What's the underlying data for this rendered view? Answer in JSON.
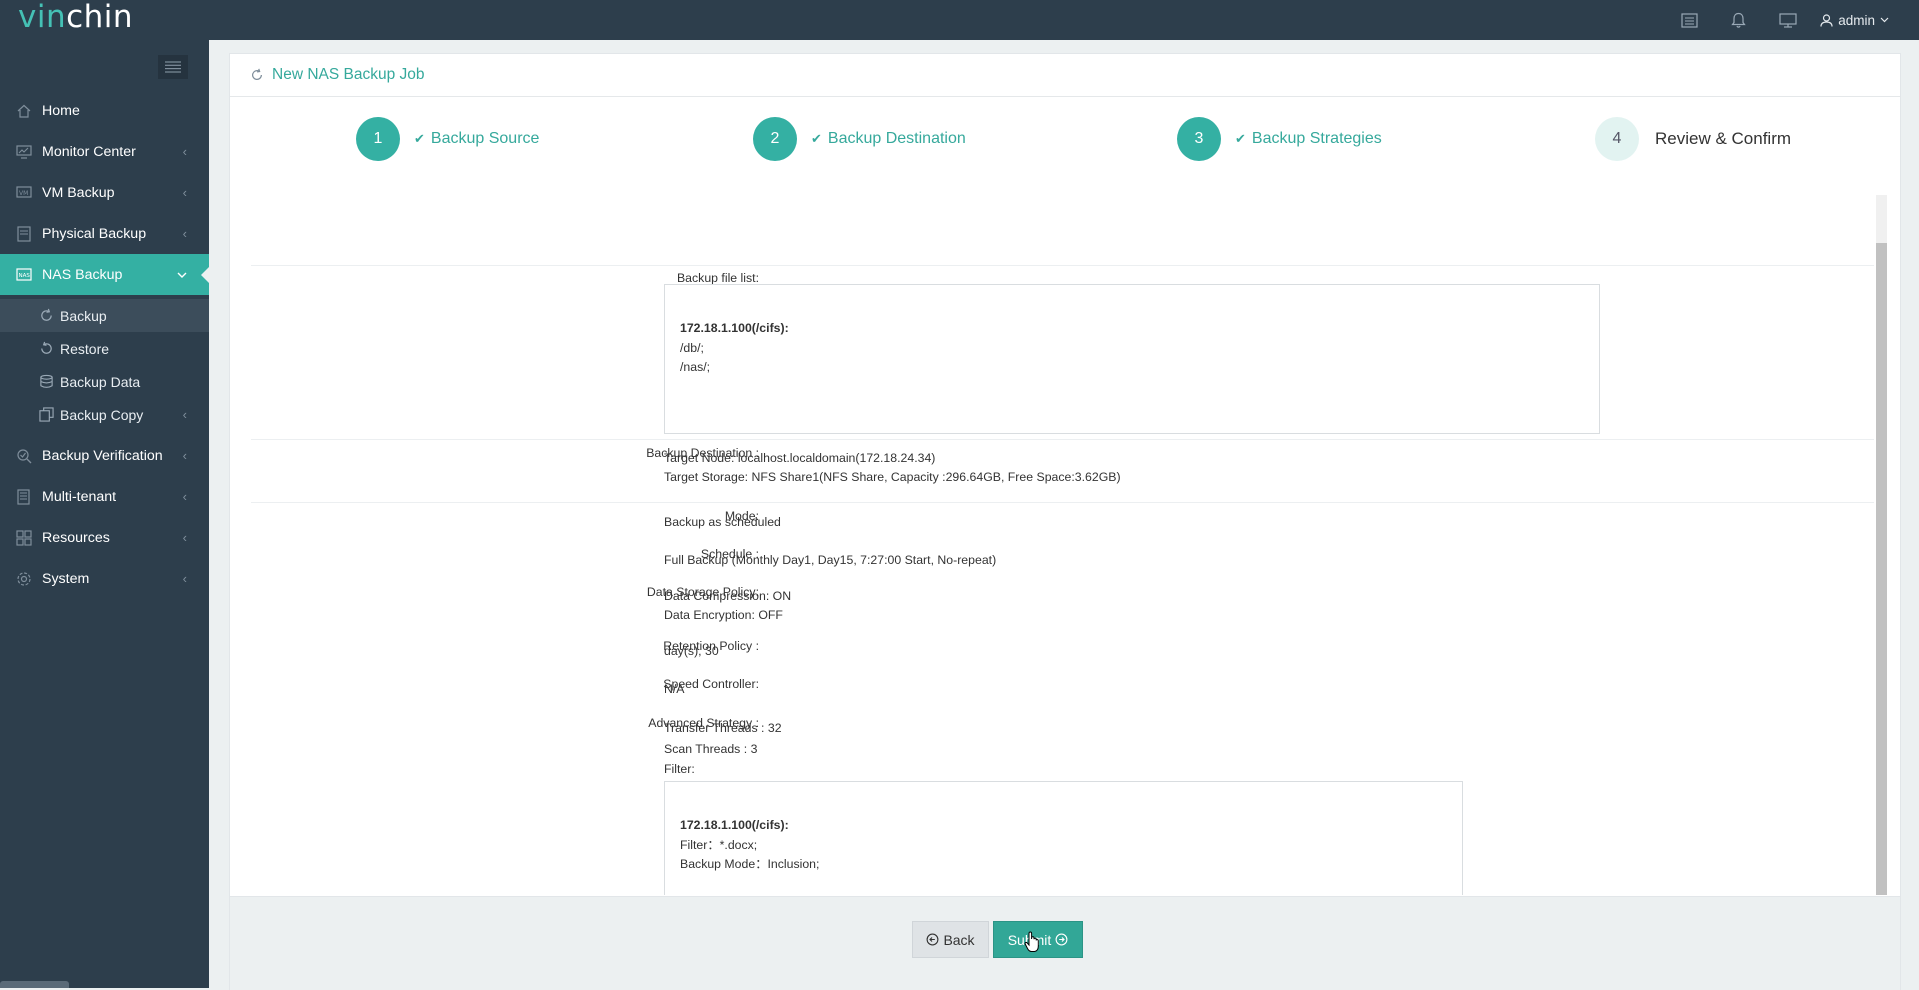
{
  "brand": {
    "part1": "vin",
    "part2": "chin"
  },
  "topbar": {
    "user": "admin",
    "icons": [
      "list-icon",
      "bell-icon",
      "monitor-icon",
      "user-icon"
    ]
  },
  "sidebar": {
    "items": [
      {
        "label": "Home",
        "icon": "home-icon"
      },
      {
        "label": "Monitor Center",
        "icon": "monitor-center-icon"
      },
      {
        "label": "VM Backup",
        "icon": "vm-backup-icon"
      },
      {
        "label": "Physical Backup",
        "icon": "physical-backup-icon"
      },
      {
        "label": "NAS Backup",
        "icon": "nas-icon"
      }
    ],
    "nas_sub": [
      {
        "label": "Backup",
        "icon": "refresh-icon"
      },
      {
        "label": "Restore",
        "icon": "restore-icon"
      },
      {
        "label": "Backup Data",
        "icon": "database-icon"
      },
      {
        "label": "Backup Copy",
        "icon": "copy-icon"
      }
    ],
    "items_after": [
      {
        "label": "Backup Verification",
        "icon": "verification-icon"
      },
      {
        "label": "Multi-tenant",
        "icon": "multi-tenant-icon"
      },
      {
        "label": "Resources",
        "icon": "resources-icon"
      },
      {
        "label": "System",
        "icon": "system-icon"
      }
    ]
  },
  "page": {
    "title": "New NAS Backup Job"
  },
  "steps": [
    {
      "num": "1",
      "label": "Backup Source"
    },
    {
      "num": "2",
      "label": "Backup Destination"
    },
    {
      "num": "3",
      "label": "Backup Strategies"
    },
    {
      "num": "4",
      "label": "Review & Confirm"
    }
  ],
  "review": {
    "backup_file_list": {
      "label": "Backup file list:",
      "host": "172.18.1.100(/cifs):",
      "paths": [
        "/db/;",
        "/nas/;"
      ]
    },
    "destination": {
      "label": "Backup Destination :",
      "node": "Target Node: localhost.localdomain(172.18.24.34)",
      "storage": "Target Storage: NFS Share1(NFS Share, Capacity :296.64GB, Free Space:3.62GB)"
    },
    "mode": {
      "label": "Mode:",
      "value": "Backup as scheduled"
    },
    "schedule": {
      "label": "Schedule :",
      "value": "Full Backup (Monthly Day1, Day15, 7:27:00 Start, No-repeat)"
    },
    "storage_policy": {
      "label": "Data Storage Policy:",
      "compression": "Data Compression: ON",
      "encryption": "Data Encryption: OFF"
    },
    "retention": {
      "label": "Retention Policy :",
      "value": "day(s), 30"
    },
    "speed": {
      "label": "Speed Controller:",
      "value": "N/A"
    },
    "advanced": {
      "label": "Advanced Strategy :",
      "transfer": "Transfer Threads : 32",
      "scan": "Scan Threads : 3",
      "filter_label": "Filter:",
      "filter_host": "172.18.1.100(/cifs):",
      "filter_value": "Filter：*.docx;",
      "filter_mode": "Backup Mode：Inclusion;"
    }
  },
  "footer": {
    "back": "Back",
    "submit": "Submit"
  }
}
